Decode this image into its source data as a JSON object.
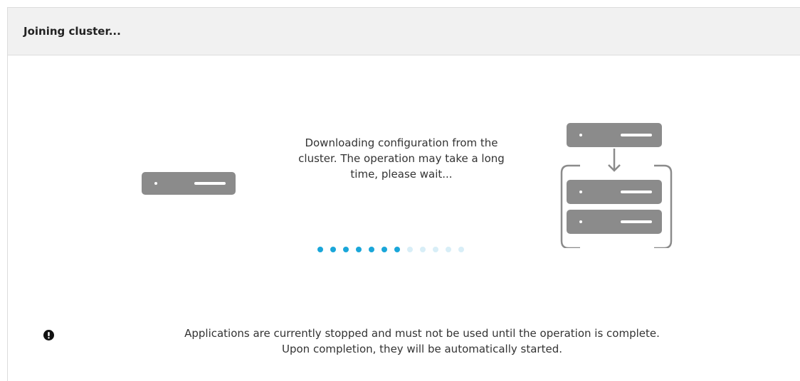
{
  "dialog": {
    "title": "Joining cluster..."
  },
  "status": {
    "message": "Downloading configuration from the cluster. The operation may take a long time, please wait...",
    "progress_dots_total": 12,
    "progress_dots_active": 7
  },
  "icons": {
    "single_server": "server-icon",
    "cluster": "cluster-servers-icon",
    "download_arrow": "arrow-down-icon",
    "warning": "exclamation-circle-icon"
  },
  "colors": {
    "accent": "#1aa6d9",
    "accent_inactive": "#d8eef7",
    "server_gray": "#8b8b8b",
    "header_bg": "#f1f1f1"
  },
  "warning": {
    "text_line1": "Applications are currently stopped and must not be used until the operation is complete.",
    "text_line2": "Upon completion, they will be automatically started."
  }
}
